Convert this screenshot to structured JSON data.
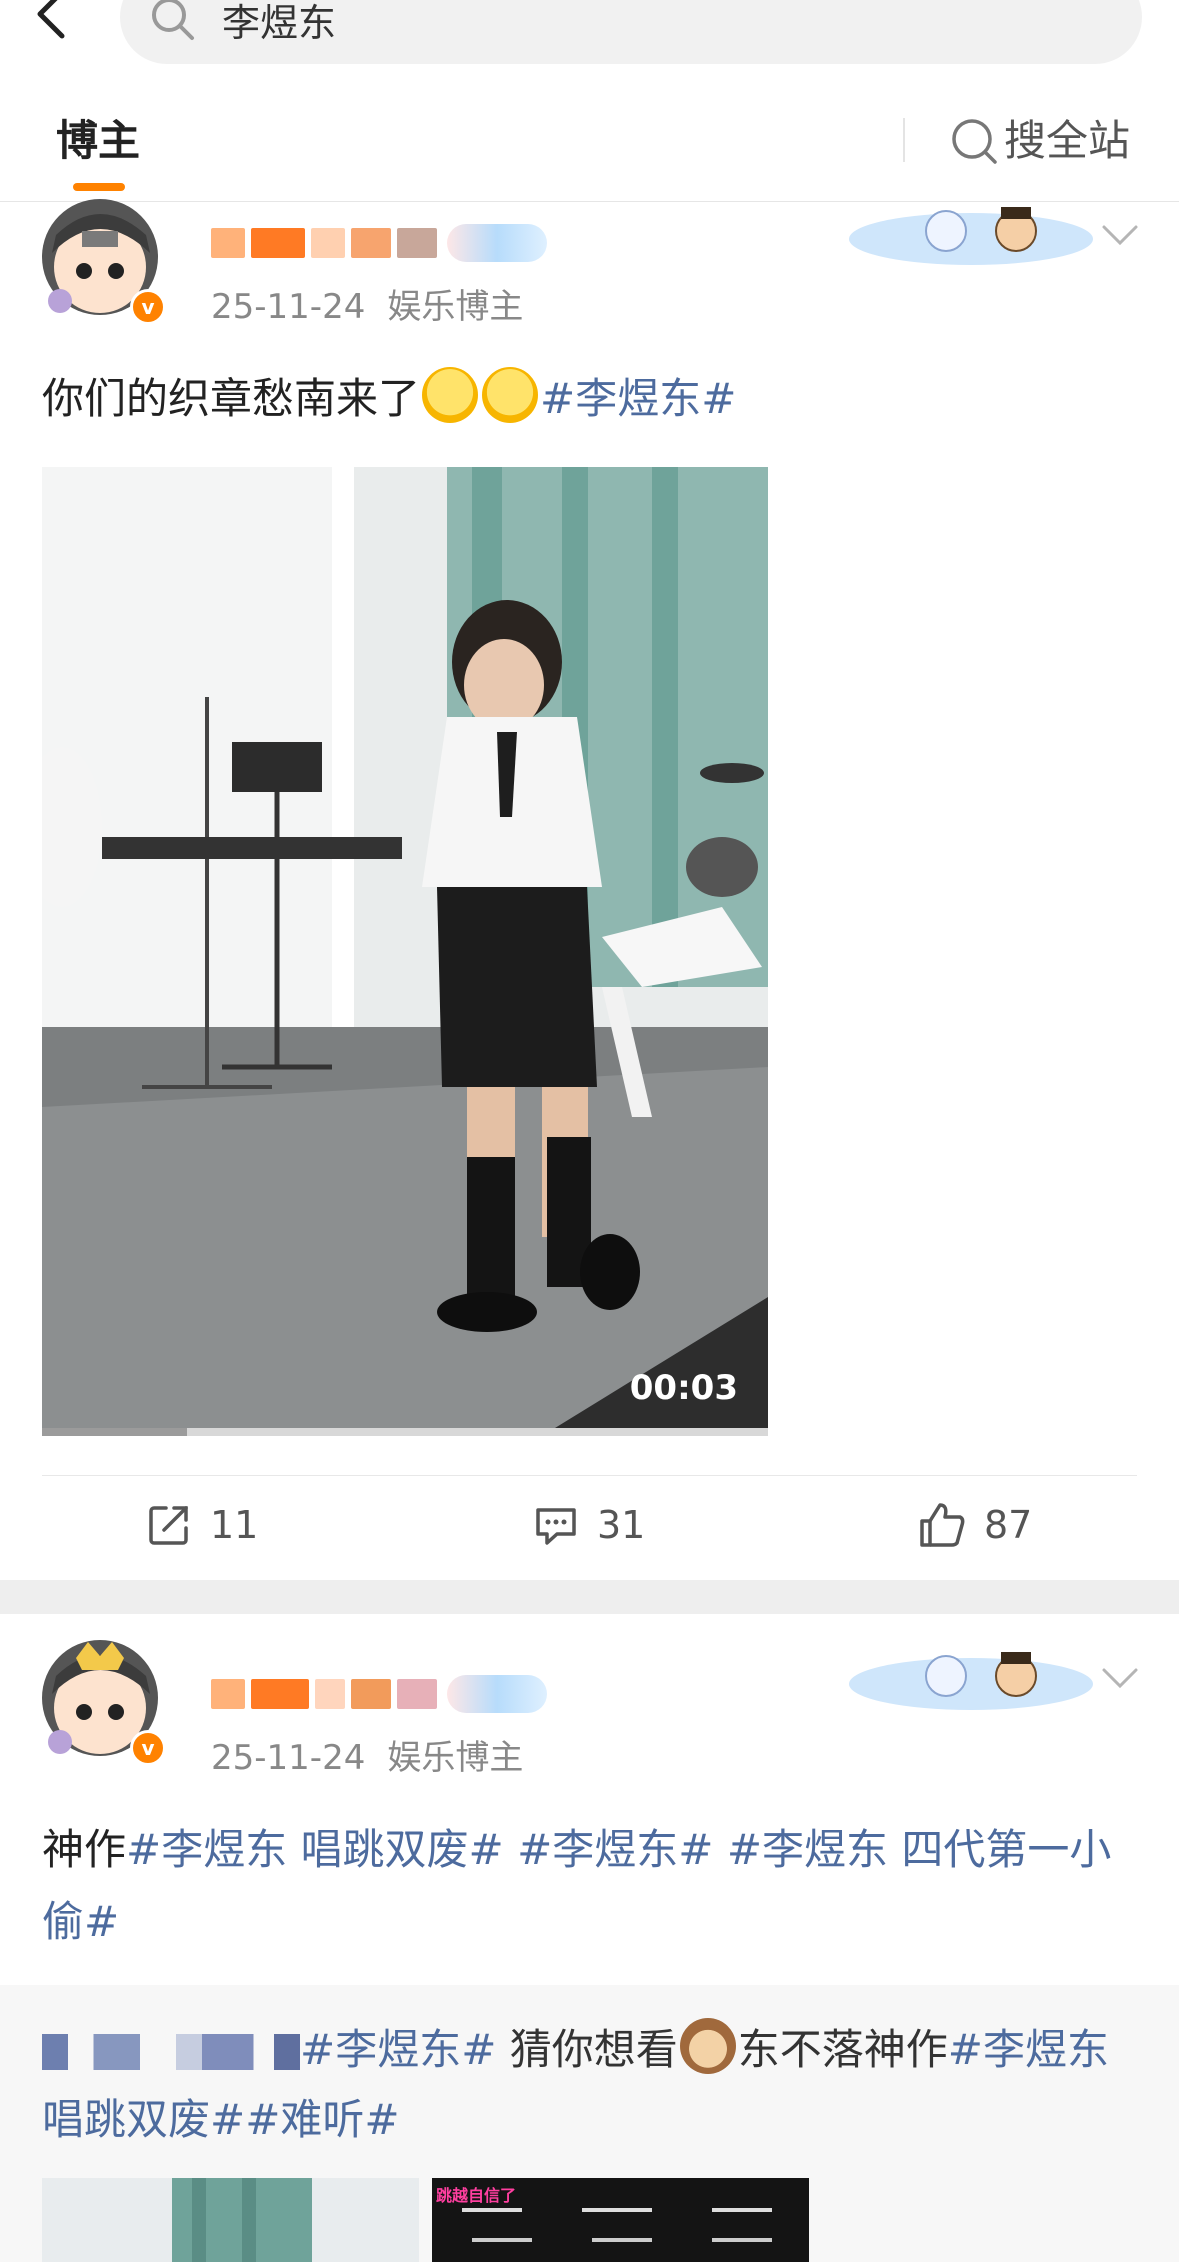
{
  "search": {
    "query": "李煜东"
  },
  "tabs": {
    "active_label": "博主",
    "search_all_label": "搜全站"
  },
  "colors": {
    "accent": "#ff8200",
    "topic_link": "#4d6b9e"
  },
  "posts": [
    {
      "date": "25-11-24",
      "role": "娱乐博主",
      "text_parts": [
        "你们的织章愁南来了",
        "#李煜东#"
      ],
      "video": {
        "duration": "00:03",
        "progress": 0.2
      },
      "actions": {
        "repost_count": "11",
        "comment_count": "31",
        "like_count": "87"
      }
    },
    {
      "date": "25-11-24",
      "role": "娱乐博主",
      "text_parts": [
        "神作",
        "#李煜东 唱跳双废#",
        "#李煜东#",
        "#李煜东 四代第一小偷#"
      ]
    }
  ],
  "repost": {
    "text_parts": [
      "#李煜东#",
      "猜你想看",
      "东不落神作",
      "#李煜东 唱跳双废#",
      "#难听#"
    ],
    "thumb2_caption": "跳越自信了"
  },
  "icons": {
    "back": "chevron-left-icon",
    "search": "search-icon",
    "more": "chevron-down-icon",
    "repost": "share-icon",
    "comment": "comment-icon",
    "like": "thumbs-up-icon"
  }
}
